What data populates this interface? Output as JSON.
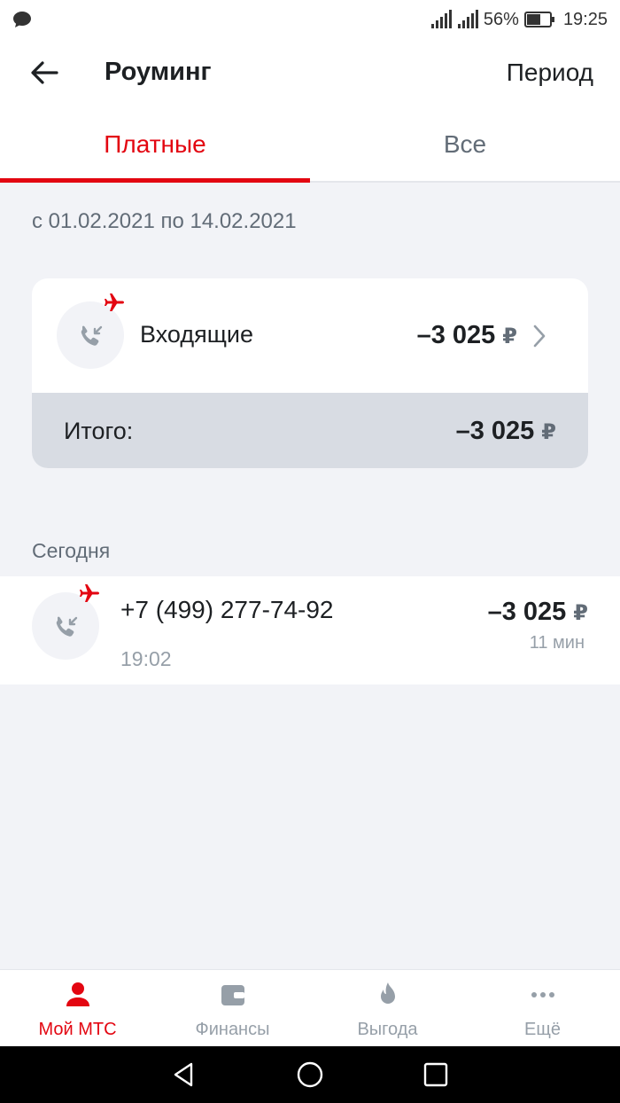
{
  "status_bar": {
    "battery": "56%",
    "time": "19:25"
  },
  "header": {
    "title": "Роуминг",
    "period_label": "Период"
  },
  "tabs": [
    {
      "label": "Платные",
      "active": true
    },
    {
      "label": "Все",
      "active": false
    }
  ],
  "date_range": "с 01.02.2021 по 14.02.2021",
  "summary": {
    "item_label": "Входящие",
    "item_amount": "–3 025",
    "total_label": "Итого:",
    "total_amount": "–3 025",
    "currency": "₽"
  },
  "section": {
    "label": "Сегодня"
  },
  "transactions": [
    {
      "phone": "+7 (499) 277-74-92",
      "time": "19:02",
      "amount": "–3 025",
      "currency": "₽",
      "duration": "11 мин"
    }
  ],
  "bottom_nav": [
    {
      "label": "Мой МТС",
      "icon": "person-icon",
      "active": true
    },
    {
      "label": "Финансы",
      "icon": "wallet-icon",
      "active": false
    },
    {
      "label": "Выгода",
      "icon": "flame-icon",
      "active": false
    },
    {
      "label": "Ещё",
      "icon": "more-icon",
      "active": false
    }
  ],
  "colors": {
    "accent": "#e30611",
    "background": "#f2f3f7",
    "total_bg": "#d8dce3",
    "muted_text": "#626c77"
  }
}
